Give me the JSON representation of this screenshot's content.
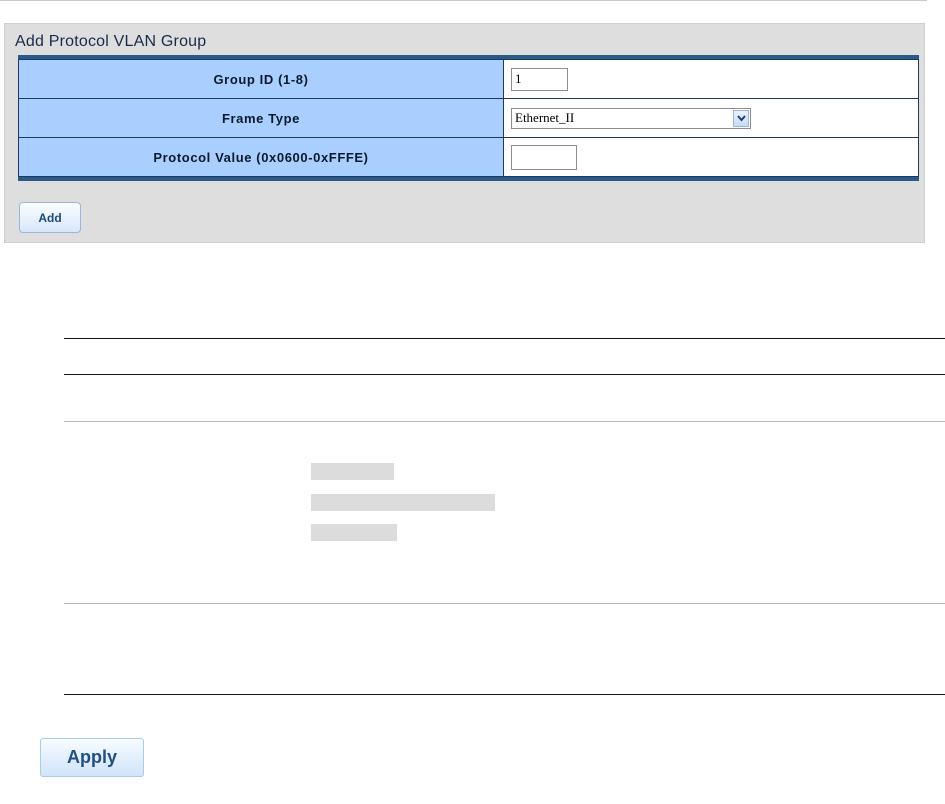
{
  "panel": {
    "title": "Add Protocol VLAN Group",
    "rows": {
      "group_id": {
        "label": "Group ID (1-8)",
        "value": "1"
      },
      "frame_type": {
        "label": "Frame Type",
        "value": "Ethernet_II"
      },
      "protocol_value": {
        "label": "Protocol Value (0x0600-0xFFFE)",
        "value": ""
      }
    },
    "add_label": "Add"
  },
  "apply_label": "Apply",
  "icons": {
    "dropdown": "chevron-down-icon"
  }
}
